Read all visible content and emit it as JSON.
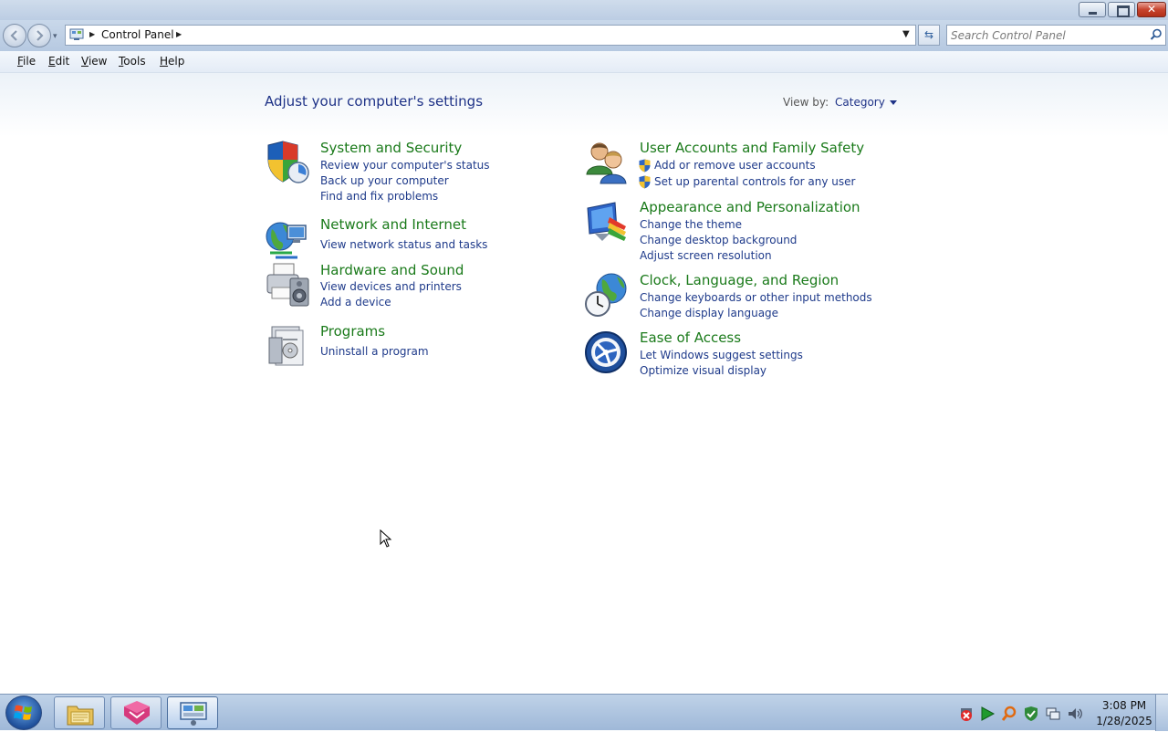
{
  "navigation": {
    "breadcrumb": "Control Panel",
    "search_placeholder": "Search Control Panel"
  },
  "menu": {
    "file": {
      "first": "F",
      "rest": "ile"
    },
    "edit": {
      "first": "E",
      "rest": "dit"
    },
    "view": {
      "first": "V",
      "rest": "iew"
    },
    "tools": {
      "first": "T",
      "rest": "ools"
    },
    "help": {
      "first": "H",
      "rest": "elp"
    }
  },
  "content": {
    "title": "Adjust your computer's settings",
    "view_by_label": "View by:",
    "view_by_value": "Category",
    "categories": [
      {
        "title": "System and Security",
        "links": [
          "Review your computer's status",
          "Back up your computer",
          "Find and fix problems"
        ]
      },
      {
        "title": "Network and Internet",
        "links": [
          "View network status and tasks"
        ]
      },
      {
        "title": "Hardware and Sound",
        "links": [
          "View devices and printers",
          "Add a device"
        ]
      },
      {
        "title": "Programs",
        "links": [
          "Uninstall a program"
        ]
      },
      {
        "title": "User Accounts and Family Safety",
        "links": [
          "Add or remove user accounts",
          "Set up parental controls for any user"
        ]
      },
      {
        "title": "Appearance and Personalization",
        "links": [
          "Change the theme",
          "Change desktop background",
          "Adjust screen resolution"
        ]
      },
      {
        "title": "Clock, Language, and Region",
        "links": [
          "Change keyboards or other input methods",
          "Change display language"
        ]
      },
      {
        "title": "Ease of Access",
        "links": [
          "Let Windows suggest settings",
          "Optimize visual display"
        ]
      }
    ]
  },
  "taskbar": {
    "time": "3:08 PM",
    "date": "1/28/2025",
    "pinned": [
      "windows-explorer",
      "app-pink",
      "control-panel"
    ]
  },
  "colors": {
    "category_title": "#1a7a1a",
    "link": "#1e3a8a",
    "heading": "#1e3287"
  }
}
